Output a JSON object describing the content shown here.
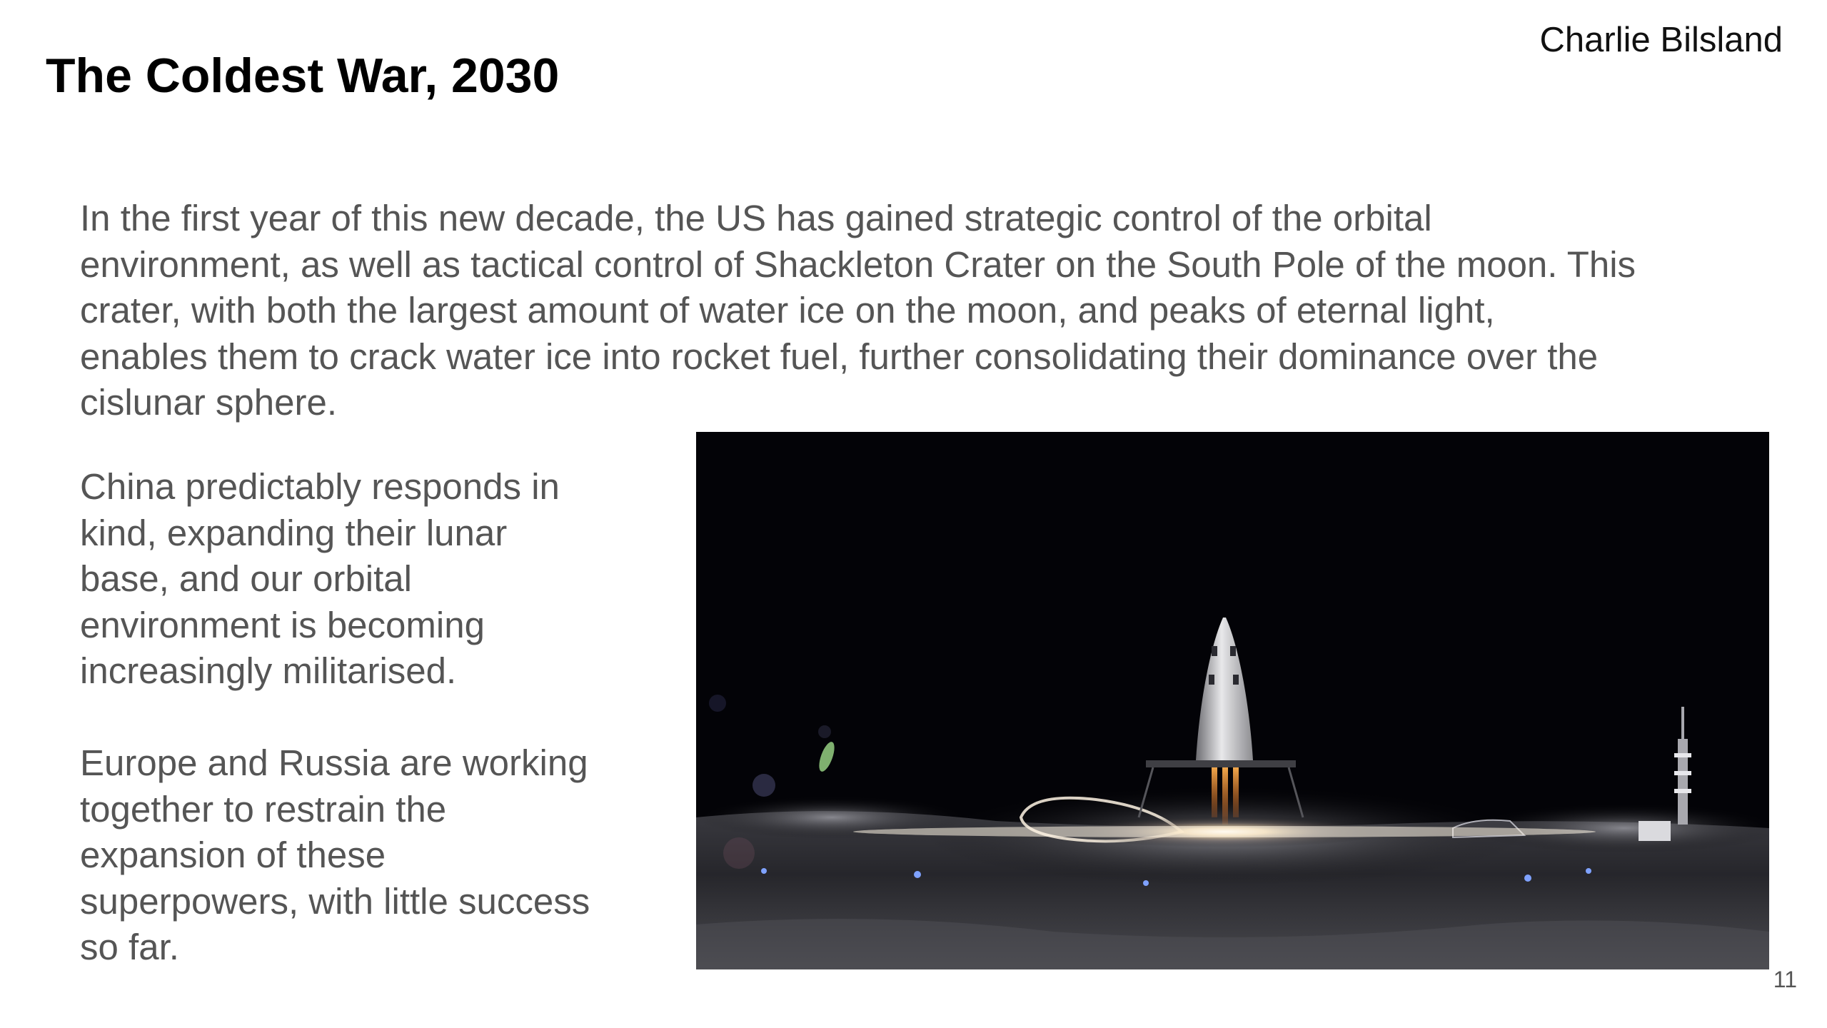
{
  "slide": {
    "title": "The Coldest War, 2030",
    "author": "Charlie Bilsland",
    "page_number": "11",
    "intro_lines": [
      "In the first year of this new decade, the US has gained strategic control of the orbital",
      "environment, as well as tactical control of Shackleton Crater on the South Pole of the moon. This",
      "crater, with both the largest amount of water ice on the moon, and peaks of eternal light,",
      "enables them to crack water ice into rocket fuel, further consolidating their dominance over the",
      "cislunar sphere."
    ],
    "side_paragraph_1_lines": [
      "China predictably responds in",
      "kind, expanding their lunar",
      "base, and our orbital",
      "environment is becoming",
      "increasingly militarised."
    ],
    "side_paragraph_2_lines": [
      "Europe and Russia are working",
      "together to restrain the",
      "expansion of these",
      "superpowers, with little success",
      "so far."
    ]
  },
  "image": {
    "subject": "lunar-base-rocket-launch-photo"
  },
  "colors": {
    "title": "#000000",
    "body_text": "#555555",
    "background": "#ffffff",
    "photo_sky": "#030307"
  }
}
